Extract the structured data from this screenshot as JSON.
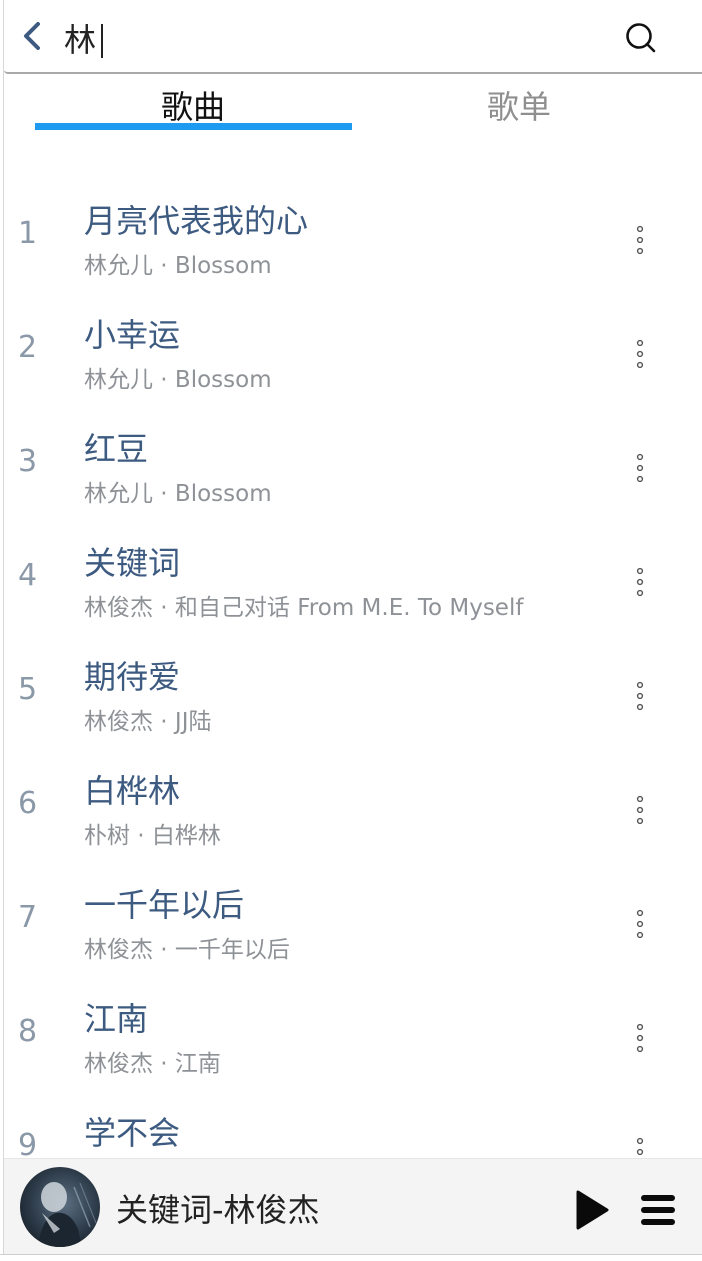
{
  "search": {
    "query": "林",
    "placeholder": ""
  },
  "icons": {
    "back": "chevron-left-icon",
    "search": "search-icon",
    "more": "more-vertical-icon",
    "play": "play-icon",
    "queue": "menu-icon"
  },
  "colors": {
    "accent": "#1e9bf0",
    "title": "#3d5a80",
    "subtitle": "#8e9297",
    "index": "#8a98a8"
  },
  "tabs": [
    {
      "label": "歌曲",
      "active": true
    },
    {
      "label": "歌单",
      "active": false
    }
  ],
  "songs": [
    {
      "index": "1",
      "title": "月亮代表我的心",
      "subtitle": "林允儿 · Blossom"
    },
    {
      "index": "2",
      "title": "小幸运",
      "subtitle": "林允儿 · Blossom"
    },
    {
      "index": "3",
      "title": "红豆",
      "subtitle": "林允儿 · Blossom"
    },
    {
      "index": "4",
      "title": "关键词",
      "subtitle": "林俊杰 · 和自己对话 From M.E. To Myself"
    },
    {
      "index": "5",
      "title": "期待爱",
      "subtitle": "林俊杰 · JJ陆"
    },
    {
      "index": "6",
      "title": "白桦林",
      "subtitle": "朴树 · 白桦林"
    },
    {
      "index": "7",
      "title": "一千年以后",
      "subtitle": "林俊杰 · 一千年以后"
    },
    {
      "index": "8",
      "title": "江南",
      "subtitle": "林俊杰 · 江南"
    },
    {
      "index": "9",
      "title": "学不会",
      "subtitle": ""
    }
  ],
  "player": {
    "now_playing": "关键词-林俊杰"
  }
}
